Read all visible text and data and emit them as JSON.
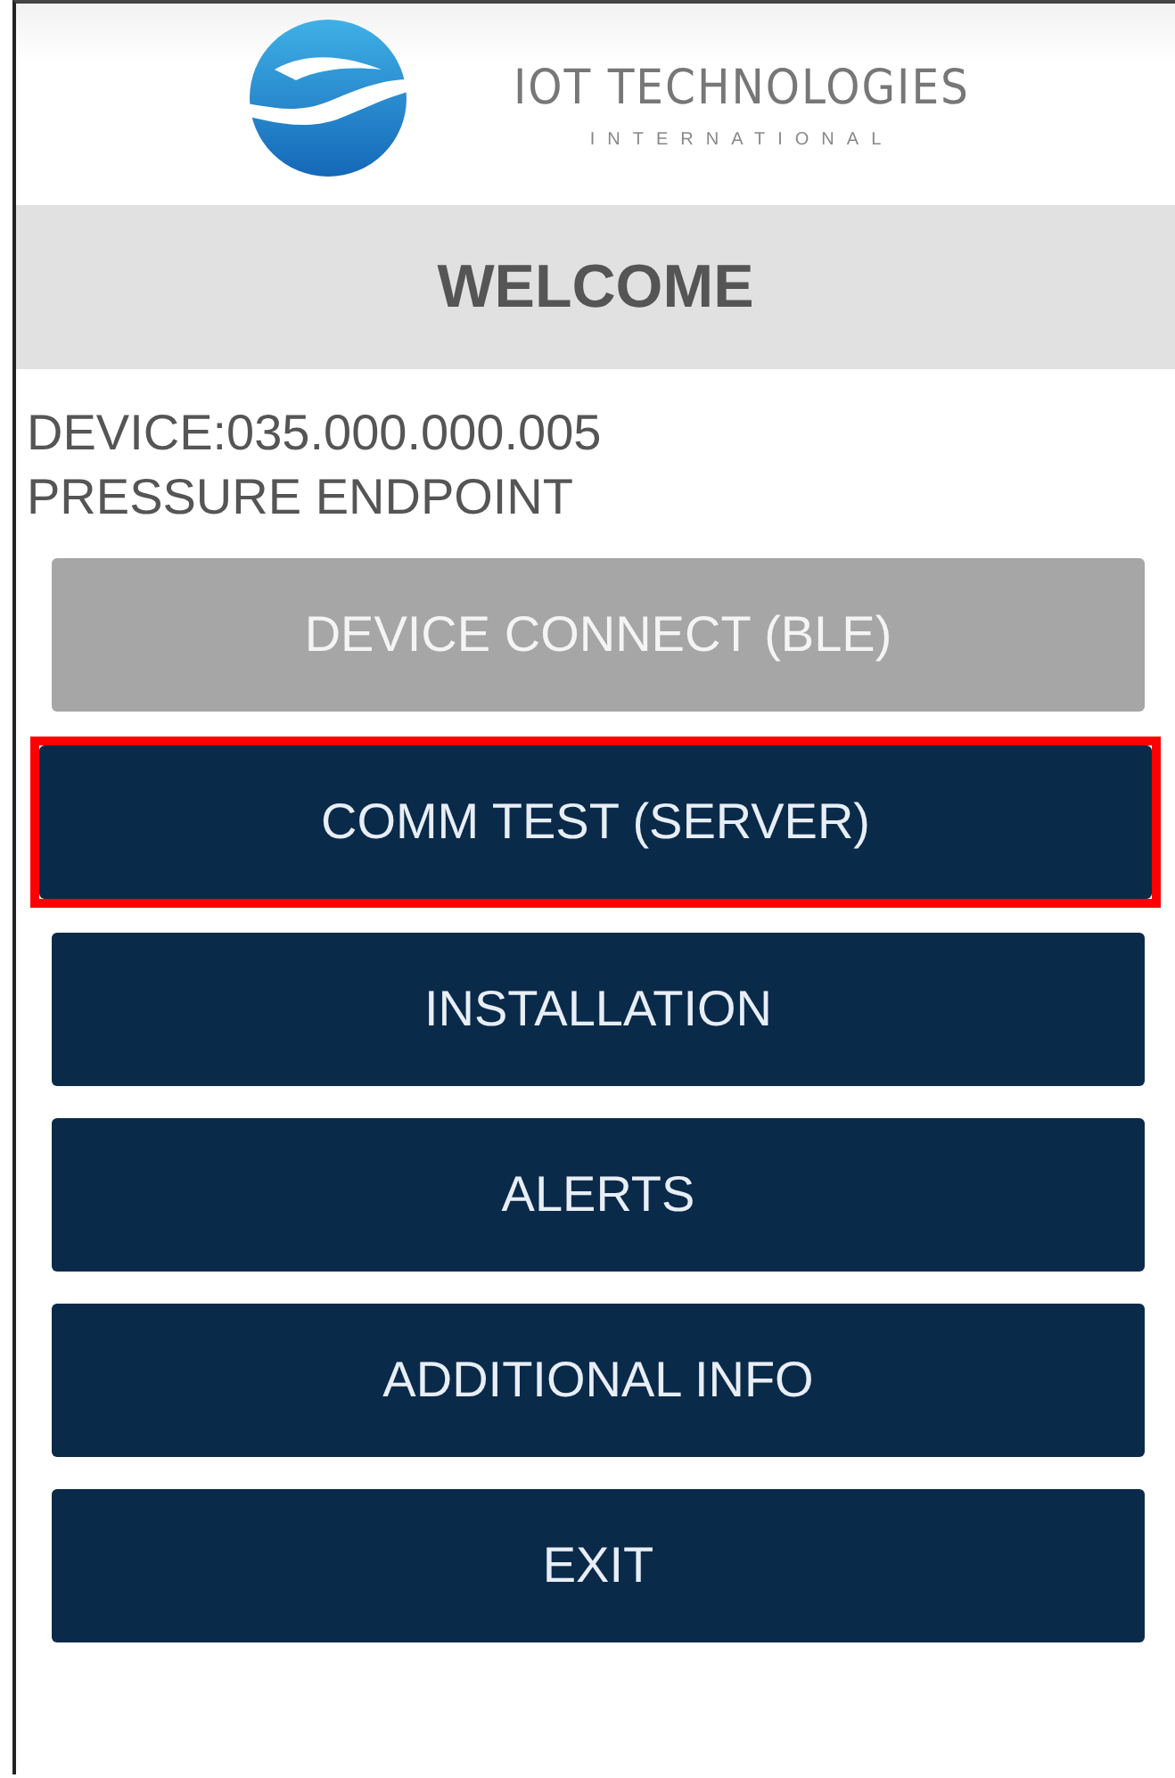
{
  "logo": {
    "name": "IOT TECHNOLOGIES",
    "subtitle": "INTERNATIONAL"
  },
  "header": {
    "title": "WELCOME"
  },
  "device": {
    "id_line": "DEVICE:035.000.000.005",
    "type_line": "PRESSURE ENDPOINT"
  },
  "buttons": [
    {
      "label": "DEVICE CONNECT (BLE)",
      "disabled": true,
      "highlighted": false
    },
    {
      "label": "COMM TEST (SERVER)",
      "disabled": false,
      "highlighted": true
    },
    {
      "label": "INSTALLATION",
      "disabled": false,
      "highlighted": false
    },
    {
      "label": "ALERTS",
      "disabled": false,
      "highlighted": false
    },
    {
      "label": "ADDITIONAL INFO",
      "disabled": false,
      "highlighted": false
    },
    {
      "label": "EXIT",
      "disabled": false,
      "highlighted": false
    }
  ]
}
